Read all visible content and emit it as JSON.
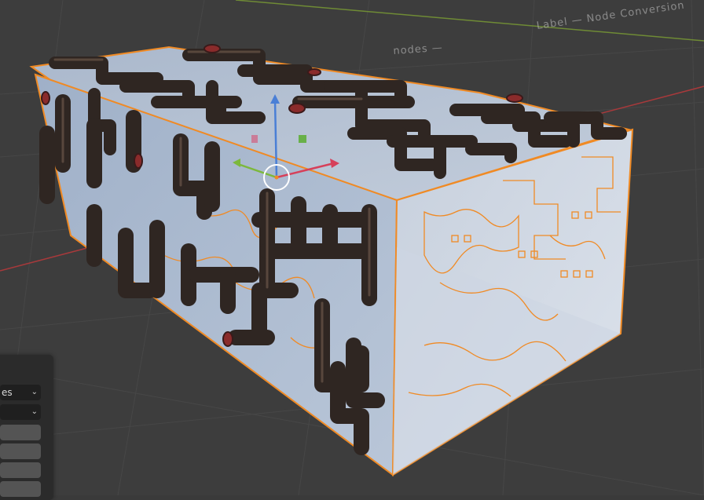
{
  "viewport": {
    "overlay_text_top_right": "Label — Node Conversion",
    "overlay_text_nodes": "nodes —",
    "colors": {
      "background": "#3d3d3d",
      "grid": "#4a4a4a",
      "x_axis": "#a8393b",
      "y_axis": "#6f8b35",
      "mesh_face": "#b8c4d6",
      "selection_outline": "#f08a24",
      "pipe": "#3a2e28"
    }
  },
  "side_panel": {
    "dropdown1_value": "es",
    "dropdown2_value": "",
    "chevron_icon": "chevron-down-icon"
  },
  "gizmo": {
    "icons": [
      "move-arrow-z-icon",
      "move-arrow-x-icon",
      "move-arrow-y-icon",
      "pivot-circle-icon"
    ]
  }
}
